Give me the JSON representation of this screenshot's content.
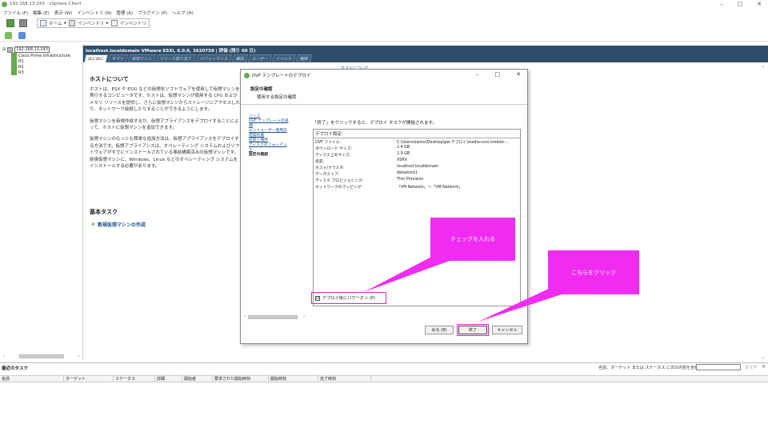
{
  "window": {
    "title": "192.168.13.243 - vSphere Client"
  },
  "menu": [
    "ファイル (F)",
    "編集 (E)",
    "表示 (W)",
    "インベントリ (N)",
    "管理 (A)",
    "プラグイン (P)",
    "ヘルプ (H)"
  ],
  "breadcrumb": {
    "home": "ホーム",
    "inventory1": "インベントリ",
    "inventory2": "インベントリ"
  },
  "tree": {
    "root": "192.168.13.243",
    "items": [
      "Cisco Prime Infrastructure",
      "R1",
      "R2",
      "R3"
    ]
  },
  "host": {
    "header": "localhost.localdomain VMware ESXi, 6.0.0, 3620759 | 評価 (残り 60 日)"
  },
  "tabs": [
    "はじめに",
    "サマリ",
    "仮想マシン",
    "リソース割り当て",
    "パフォーマンス",
    "構成",
    "ユーザー",
    "イベント",
    "権限"
  ],
  "about": {
    "title": "ホストについて",
    "p1": "ホストは、ESX や ESXi などの仮想化ソフトウェアを使用して仮想マシンを実行するコンピュータです。ホストは、仮想マシンが使用する CPU およびメモリ リソースを提供し、さらに仮想マシンからストレージにアクセスしたり、ネットワーク接続したりすることができるようにします。",
    "p2": "仮想マシンを新規作成するか、仮想アプライアンスをデプロイすることによって、ホストに仮想マシンを追加できます。",
    "p3": "仮想マシンのもっとも簡単な追加方法は、仮想アプライアンスをデプロイする方法です。仮想アプライアンスは、オペレーティング システムおよびソフトウェアがすでにインストールされている事前構築済みの仮想マシンです。新規仮想マシンに、Windows、Linux などのオペレーティング システムをインストールする必要があります。"
  },
  "help": {
    "label": "ホストについて"
  },
  "basic_tasks": {
    "title": "基本タスク",
    "link": "新規仮想マシンの作成"
  },
  "dialog": {
    "title": "OVF テンプレートのデプロイ",
    "head1": "設定の確認",
    "head2": "使用する設定の確認",
    "steps": [
      "ソース",
      "OVF テンプレートの詳細",
      "エンドユーザー使用許諾契約書",
      "名前と場所",
      "ディスクのフォーマット",
      "設定の確認"
    ],
    "description": "「終了」をクリックすると、デプロイ タスクが開始されます。",
    "settings_header": "デプロイ設定:",
    "settings": [
      {
        "key": "OVF ファイル:",
        "value": "C:\\Users\\kaimo\\Desktop\\pw-デプロイ\\media-vsrx-vmdisk-..."
      },
      {
        "key": "ダウンロード サイズ:",
        "value": "2.4 GB"
      },
      {
        "key": "ディスク上のサイズ:",
        "value": "2.9 GB"
      },
      {
        "key": "名前:",
        "value": "VSRX"
      },
      {
        "key": "ホスト/クラスタ:",
        "value": "localhost.localdomain"
      },
      {
        "key": "データストア:",
        "value": "datastore1"
      },
      {
        "key": "ディスク プロビジョニング:",
        "value": "Thin Provision"
      },
      {
        "key": "ネットワークのマッピング:",
        "value": "「VM Network」〜「VM Network」"
      }
    ],
    "checkbox_label": "デプロイ後にパワーオン (P)",
    "checkbox_mark": "☑",
    "btn_back": "戻る (B)",
    "btn_finish": "終了",
    "btn_cancel": "キャンセル"
  },
  "callouts": {
    "check": "チェックを入れる",
    "click": "こちらをクリック",
    "color": "#f12cf1"
  },
  "recent": {
    "title": "最近のタスク",
    "filter_label": "名前、ターゲット または ステータス に次の内容を含む：",
    "clear": "クリア",
    "columns": [
      "名前",
      "ターゲット",
      "ステータス",
      "詳細",
      "開始者",
      "要求された開始時刻",
      "開始時刻",
      "完了時刻"
    ]
  }
}
